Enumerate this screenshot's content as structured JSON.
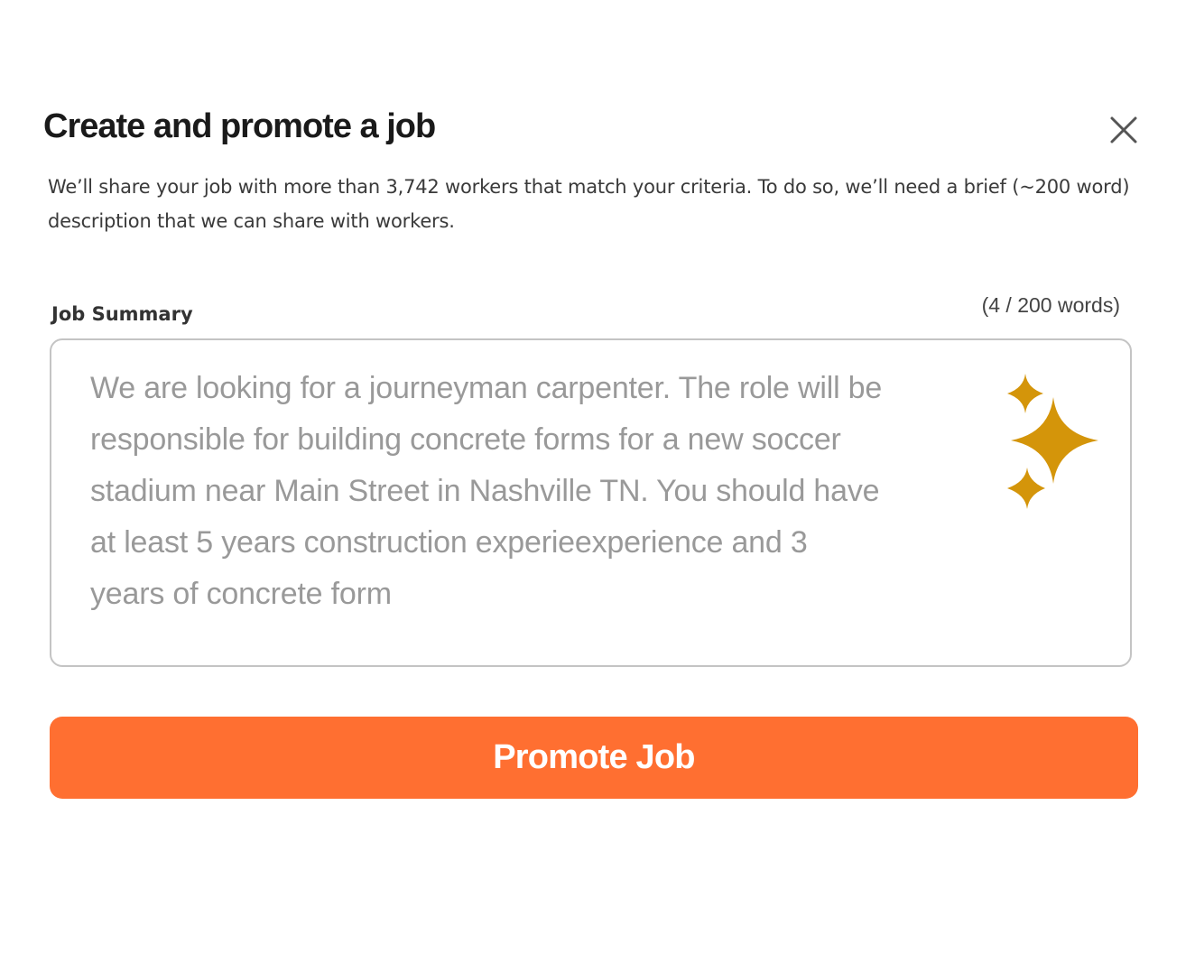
{
  "dialog": {
    "title": "Create and promote a job",
    "description": "We’ll share your job with more than 3,742 workers that match your criteria. To do so, we’ll need a brief (~200 word) description that we can share with workers.",
    "close_icon": "close-icon"
  },
  "summary": {
    "label": "Job Summary",
    "word_count": "(4 / 200 words)",
    "text": "We are looking for a journeyman carpenter. The role will be responsible for building concrete forms for a new soccer stadium near Main Street in Nashville TN. You should have at least 5 years construction experieexperience and 3 years of concrete form",
    "ai_icon": "sparkles-icon",
    "accent_color": "#d4950a"
  },
  "actions": {
    "promote_label": "Promote Job",
    "promote_color": "#ff6f31"
  }
}
